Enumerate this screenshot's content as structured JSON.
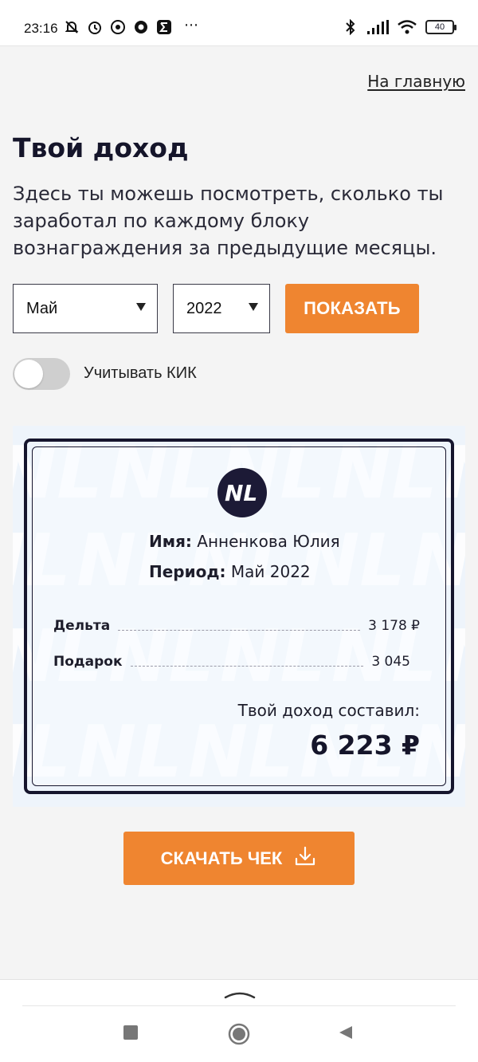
{
  "status_bar": {
    "time": "23:16",
    "dots": "⋯",
    "battery": "40",
    "icons": [
      "mute-icon",
      "alarm-icon",
      "whatsapp-icon",
      "chrome-icon",
      "sigma-icon",
      "bluetooth-icon",
      "signal-icon",
      "wifi-icon",
      "battery-icon"
    ]
  },
  "header": {
    "home_link": "На главную"
  },
  "main": {
    "title": "Твой доход",
    "description": "Здесь ты можешь посмотреть, сколько ты заработал по каждому блоку вознаграждения за предыдущие месяцы.",
    "month_select": "Май",
    "year_select": "2022",
    "show_button": "ПОКАЗАТЬ",
    "toggle_label": "Учитывать КИК",
    "toggle_on": false
  },
  "receipt": {
    "logo_text": "NL",
    "name_label": "Имя:",
    "name_value": "Анненкова Юлия",
    "period_label": "Период:",
    "period_value": "Май 2022",
    "rows": [
      {
        "label": "Дельта",
        "value": "3 178 ₽"
      },
      {
        "label": "Подарок",
        "value": "3 045"
      }
    ],
    "total_label": "Твой доход составил:",
    "total_value": "6 223 ₽"
  },
  "download_button": "СКАЧАТЬ ЧЕК",
  "colors": {
    "accent": "#ef8530",
    "dark": "#16152d",
    "receipt_bg": "#eef4fb"
  }
}
